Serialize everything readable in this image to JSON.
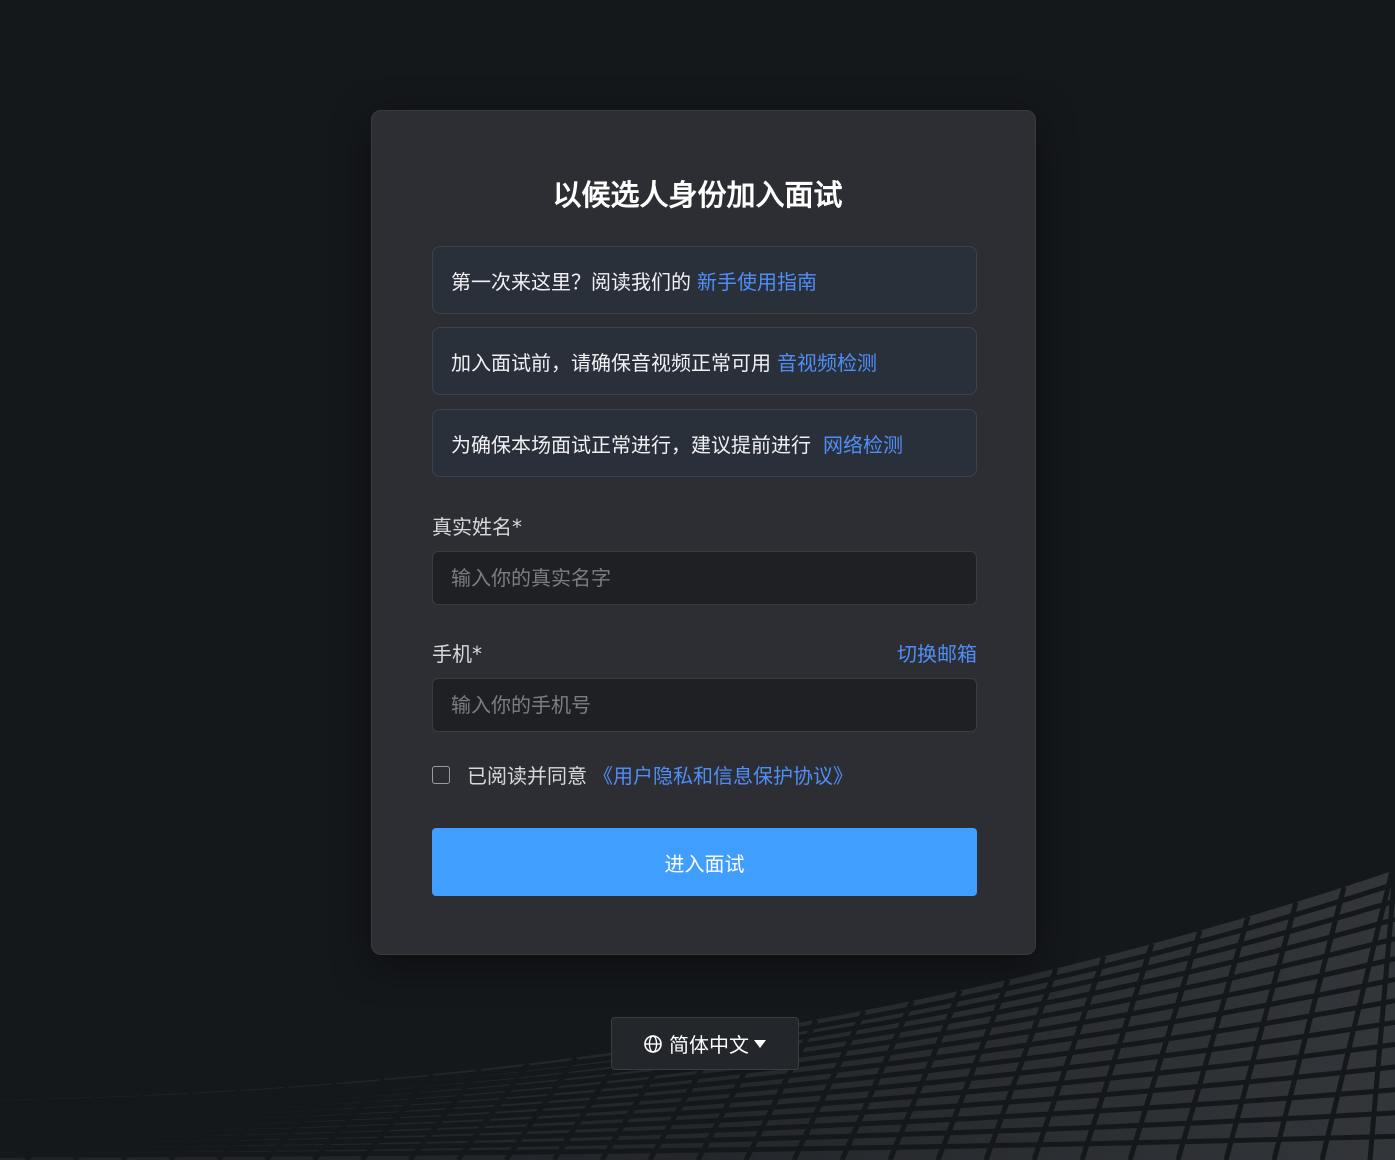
{
  "title": "以候选人身份加入面试",
  "notices": [
    {
      "text": "第一次来这里？阅读我们的",
      "link": "新手使用指南"
    },
    {
      "text": "加入面试前，请确保音视频正常可用",
      "link": "音视频检测"
    },
    {
      "text": "为确保本场面试正常进行，建议提前进行",
      "link": "网络检测"
    }
  ],
  "form": {
    "name_label": "真实姓名*",
    "name_placeholder": "输入你的真实名字",
    "name_value": "",
    "phone_label": "手机*",
    "switch_label": "切换邮箱",
    "phone_placeholder": "输入你的手机号",
    "phone_value": "",
    "agree_text": "已阅读并同意",
    "agree_link": "《用户隐私和信息保护协议》",
    "agree_checked": false,
    "submit_label": "进入面试"
  },
  "language": {
    "selected": "简体中文",
    "icon": "globe-icon"
  },
  "colors": {
    "background": "#15181b",
    "card": "#2d2e33",
    "accent": "#409eff",
    "link": "#4f8ef7"
  }
}
